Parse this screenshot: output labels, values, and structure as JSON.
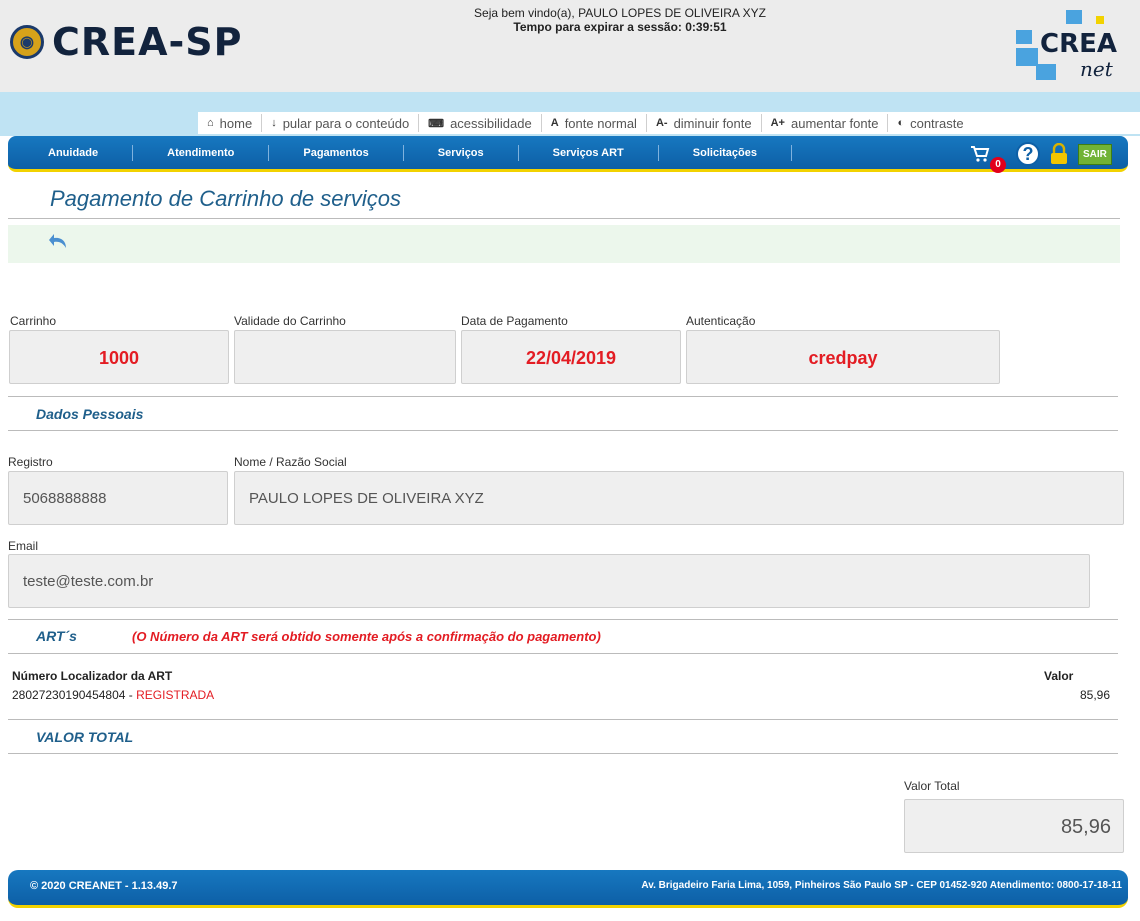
{
  "header": {
    "logo_text": "CREA-SP",
    "welcome_line": "Seja bem vindo(a), PAULO LOPES DE OLIVEIRA XYZ",
    "session_line": "Tempo para expirar a sessão: 0:39:51",
    "creanet_logo": {
      "line1": "CREA",
      "line2": "net"
    }
  },
  "accessibility_bar": [
    {
      "icon": "home-icon",
      "glyph": "⌂",
      "label": "home"
    },
    {
      "icon": "arrow-down-icon",
      "glyph": "↓",
      "label": "pular para o conteúdo"
    },
    {
      "icon": "keyboard-icon",
      "glyph": "⌨",
      "label": "acessibilidade"
    },
    {
      "icon": "font-normal-icon",
      "glyph": "A",
      "label": "fonte normal"
    },
    {
      "icon": "font-decrease-icon",
      "glyph": "A-",
      "label": "diminuir fonte"
    },
    {
      "icon": "font-increase-icon",
      "glyph": "A+",
      "label": "aumentar fonte"
    },
    {
      "icon": "contrast-icon",
      "glyph": "◐",
      "label": "contraste"
    }
  ],
  "menu": [
    "Anuidade",
    "Atendimento",
    "Pagamentos",
    "Serviços",
    "Serviços ART",
    "Solicitações"
  ],
  "menu_right": {
    "cart_count": "0",
    "help_glyph": "?",
    "logout_label": "SAIR"
  },
  "page": {
    "title": "Pagamento de Carrinho de serviços"
  },
  "summary": {
    "carrinho_label": "Carrinho",
    "carrinho_value": "1000",
    "validade_label": "Validade do Carrinho",
    "validade_value": "",
    "data_label": "Data de Pagamento",
    "data_value": "22/04/2019",
    "autenticacao_label": "Autenticação",
    "autenticacao_value": "credpay"
  },
  "dados": {
    "section_title": "Dados Pessoais",
    "registro_label": "Registro",
    "registro_value": "5068888888",
    "nome_label": "Nome / Razão Social",
    "nome_value": "PAULO LOPES DE OLIVEIRA XYZ",
    "email_label": "Email",
    "email_value": "teste@teste.com.br"
  },
  "arts": {
    "section_title": "ART´s",
    "notice": "(O Número da ART será obtido somente após a confirmação do pagamento)",
    "col_numero": "Número Localizador da ART",
    "col_valor": "Valor",
    "rows": [
      {
        "numero": "28027230190454804",
        "sep": " - ",
        "status": "REGISTRADA",
        "valor": "85,96"
      }
    ]
  },
  "total": {
    "section_title": "VALOR TOTAL",
    "label": "Valor Total",
    "value": "85,96"
  },
  "footer": {
    "left": "© 2020 CREANET -  1.13.49.7",
    "right": "Av. Brigadeiro Faria Lima, 1059, Pinheiros São Paulo SP - CEP 01452-920 Atendimento: 0800-17-18-11"
  },
  "colors": {
    "brand_blue": "#0d5fa6",
    "accent_yellow": "#f2d200",
    "value_red": "#e31c23",
    "title_blue": "#1f5f8b"
  }
}
